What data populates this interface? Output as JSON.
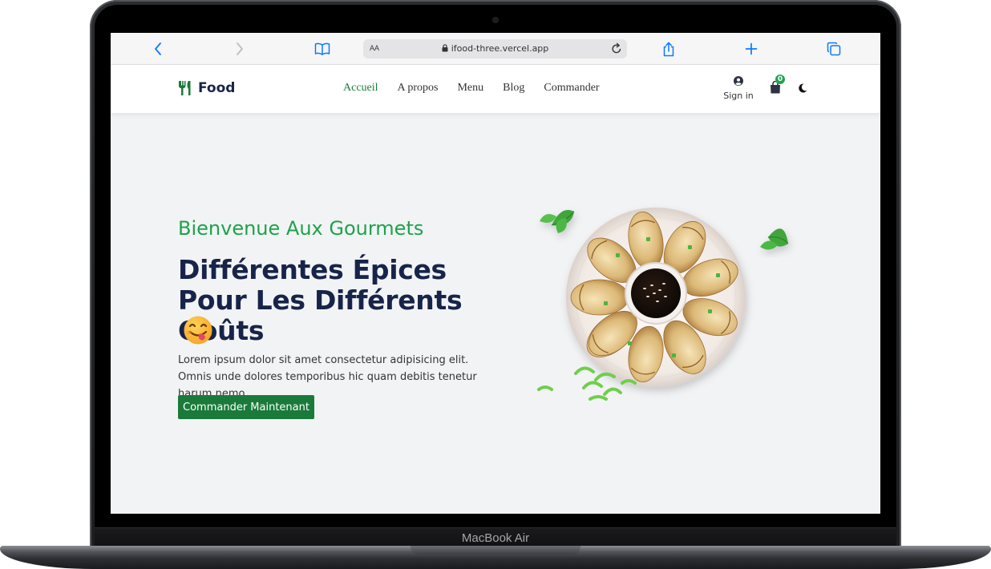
{
  "device": {
    "label": "MacBook Air"
  },
  "browser": {
    "url_text_size": "AA",
    "url": "ifood-three.vercel.app"
  },
  "site": {
    "logo_text": "Food",
    "nav": [
      {
        "label": "Accueil",
        "active": true
      },
      {
        "label": "A propos",
        "active": false
      },
      {
        "label": "Menu",
        "active": false
      },
      {
        "label": "Blog",
        "active": false
      },
      {
        "label": "Commander",
        "active": false
      }
    ],
    "signin_label": "Sign in",
    "cart_count": "0"
  },
  "hero": {
    "subtitle": "Bienvenue Aux Gourmets",
    "title": "Différentes Épices Pour Les Différents Goûts",
    "description": "Lorem ipsum dolor sit amet consectetur adipisicing elit. Omnis unde dolores temporibus hic quam debitis tenetur harum nemo.",
    "cta_label": "Commander Maintenant"
  },
  "colors": {
    "brand_green": "#1a7a3a",
    "accent_green": "#1ea24a",
    "navy": "#17244a",
    "page_bg": "#f2f3f5",
    "browser_accent": "#0a7aff"
  }
}
